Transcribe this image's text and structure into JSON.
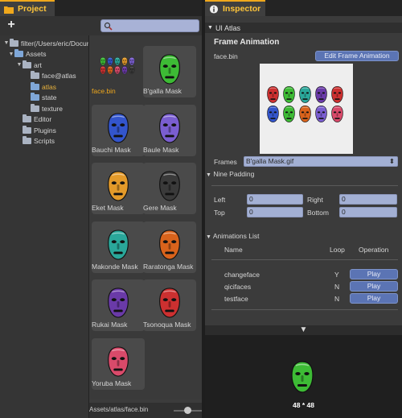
{
  "project": {
    "tab_label": "Project",
    "add_label": "+",
    "search": {
      "value": ""
    },
    "tree": [
      {
        "label": "filter(/Users/eric/Documents",
        "arrow": "▼",
        "folder": "plain"
      },
      {
        "label": "Assets",
        "arrow": "▼",
        "folder": "blue"
      },
      {
        "label": "art",
        "arrow": "▼",
        "folder": "plain"
      },
      {
        "label": "face@atlas",
        "arrow": "",
        "folder": "plain"
      },
      {
        "label": "atlas",
        "arrow": "",
        "folder": "blue",
        "selected": true
      },
      {
        "label": "state",
        "arrow": "",
        "folder": "blue"
      },
      {
        "label": "texture",
        "arrow": "",
        "folder": "plain"
      },
      {
        "label": "Editor",
        "arrow": "",
        "folder": "plain"
      },
      {
        "label": "Plugins",
        "arrow": "",
        "folder": "plain"
      },
      {
        "label": "Scripts",
        "arrow": "",
        "folder": "plain"
      }
    ],
    "assets": [
      {
        "label": "face.bin",
        "kind": "atlas",
        "selected": true
      },
      {
        "label": "B'galla Mask",
        "kind": "green",
        "bg": true
      },
      {
        "label": "Bauchi Mask",
        "kind": "blue",
        "bg": true
      },
      {
        "label": "Baule Mask",
        "kind": "purple",
        "bg": true
      },
      {
        "label": "Eket Mask",
        "kind": "orange",
        "bg": true
      },
      {
        "label": "Gere Mask",
        "kind": "black",
        "bg": true
      },
      {
        "label": "Makonde Mask",
        "kind": "teal",
        "bg": true
      },
      {
        "label": "Raratonga Mask",
        "kind": "darkorange",
        "bg": true
      },
      {
        "label": "Rukai Mask",
        "kind": "violet",
        "bg": true
      },
      {
        "label": "Tsonoqua Mask",
        "kind": "red",
        "bg": true
      },
      {
        "label": "Yoruba Mask",
        "kind": "pink",
        "bg": true
      }
    ],
    "collapse_glyph": "◀",
    "footer_path": "Assets/atlas/face.bin"
  },
  "inspector": {
    "tab_label": "Inspector",
    "header_label": "UI Atlas",
    "header_arrow": "▼",
    "section_title": "Frame Animation",
    "file_name": "face.bin",
    "edit_button": "Edit Frame Animation",
    "frames_label": "Frames",
    "frames_value": "B'galla Mask.gif",
    "frames_select_arrow": "⬍",
    "nine_padding_label": "Nine Padding",
    "padding": {
      "left_label": "Left",
      "left_value": "0",
      "right_label": "Right",
      "right_value": "0",
      "top_label": "Top",
      "top_value": "0",
      "bottom_label": "Bottom",
      "bottom_value": "0"
    },
    "animations_label": "Animations List",
    "columns": {
      "name": "Name",
      "loop": "Loop",
      "operation": "Operation"
    },
    "animations": [
      {
        "name": "changeface",
        "loop": "Y",
        "action": "Play"
      },
      {
        "name": "qicifaces",
        "loop": "N",
        "action": "Play"
      },
      {
        "name": "testface",
        "loop": "N",
        "action": "Play"
      }
    ],
    "expand_glyph": "▼",
    "preview_size": "48 * 48"
  },
  "colors": {
    "accent": "#f0a81c",
    "button": "#5b74b4",
    "field": "#a3b0d4"
  },
  "masks": {
    "green": "#3dbb35",
    "blue": "#3355cc",
    "purple": "#7a5ed0",
    "orange": "#e39a2a",
    "black": "#3a3a3a",
    "teal": "#2aa79a",
    "darkorange": "#d9631c",
    "violet": "#6a3aa8",
    "red": "#cc3030",
    "pink": "#d94a6a"
  }
}
